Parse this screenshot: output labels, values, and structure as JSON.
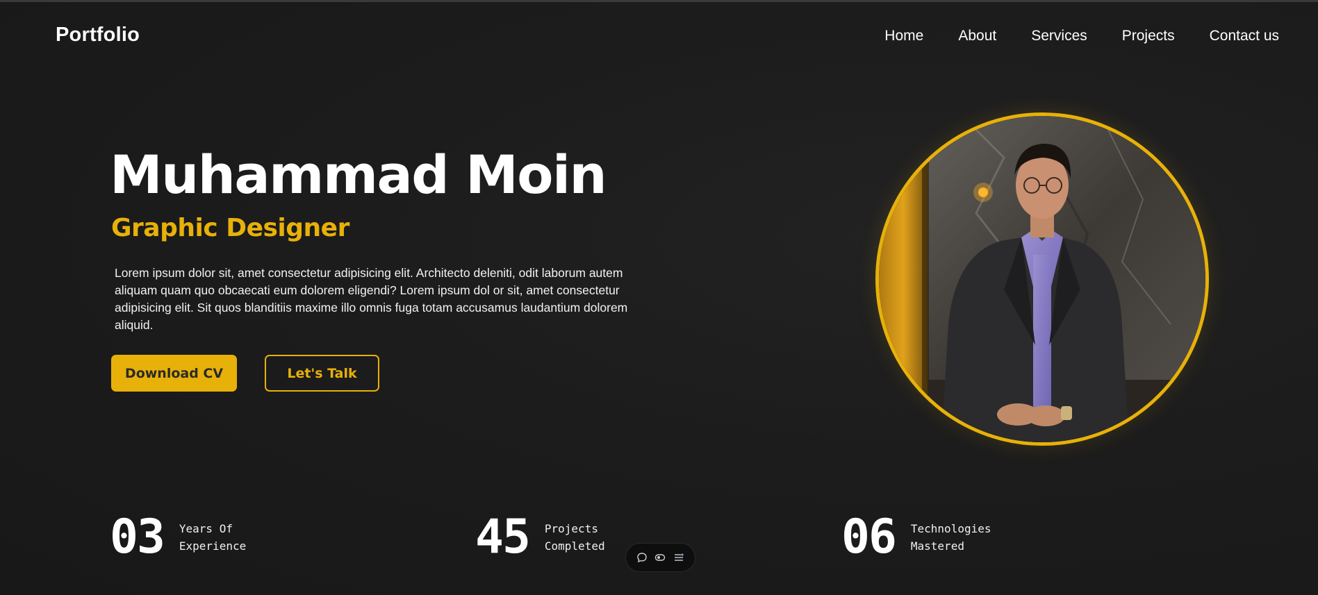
{
  "nav": {
    "logo": "Portfolio",
    "links": [
      "Home",
      "About",
      "Services",
      "Projects",
      "Contact us"
    ]
  },
  "hero": {
    "name": "Muhammad Moin",
    "role": "Graphic Designer",
    "bio": "Lorem ipsum dolor sit, amet consectetur adipisicing elit. Architecto deleniti, odit laborum autem aliquam quam quo obcaecati eum dolorem eligendi? Lorem ipsum dol or sit, amet consectetur adipisicing elit. Sit quos blanditiis maxime illo omnis fuga totam accusamus laudantium dolorem aliquid.",
    "primary_button": "Download CV",
    "secondary_button": "Let's Talk"
  },
  "stats": [
    {
      "number": "03",
      "label": "Years Of Experience"
    },
    {
      "number": "45",
      "label": "Projects Completed"
    },
    {
      "number": "06",
      "label": "Technologies Mastered"
    }
  ],
  "toolbar": {
    "icons": [
      "comment-icon",
      "toggle-icon",
      "list-settings-icon"
    ]
  },
  "colors": {
    "accent": "#e8b109",
    "background": "#1b1b1b",
    "text": "#ffffff"
  }
}
